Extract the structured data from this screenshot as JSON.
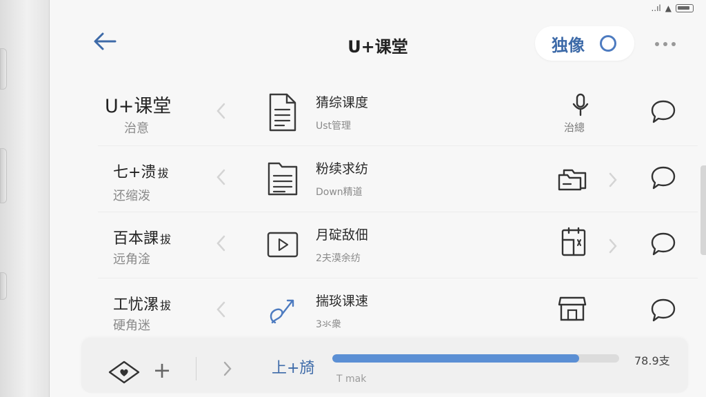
{
  "status": {
    "signal": "..ıl",
    "wifi": "▲"
  },
  "header": {
    "title": "U+课堂",
    "pill_label": "独像"
  },
  "rows": [
    {
      "left_title": "U+课堂",
      "left_tag": "",
      "left_sub": "治意",
      "item_title": "猜综课度",
      "item_sub": "Ust管理",
      "action_label": "治總",
      "action_icon": "mic-icon",
      "item_icon": "document-icon"
    },
    {
      "left_title": "七+溃",
      "left_tag": "拔",
      "left_sub": "还缩泼",
      "item_title": "粉续求纺",
      "item_sub": "Down精道",
      "action_label": "",
      "action_icon": "folders-icon",
      "item_icon": "folder-document-icon"
    },
    {
      "left_title": "百本課",
      "left_tag": "拔",
      "left_sub": "远角淦",
      "item_title": "月碇敌佃",
      "item_sub": "2夫漠余纺",
      "action_label": "",
      "action_icon": "clipboard-icon",
      "item_icon": "play-icon"
    },
    {
      "left_title": "工忧漯",
      "left_tag": "拔",
      "left_sub": "硬角迷",
      "item_title": "揣琰课速",
      "item_sub": "3氺衆",
      "action_label": "",
      "action_icon": "store-icon",
      "item_icon": "link-icon"
    }
  ],
  "bottom_bar": {
    "label": "上+旑",
    "progress": 0.86,
    "progress_value": "78.9支",
    "progress_sub": "T mak"
  },
  "colors": {
    "accent": "#3d6aa8",
    "progress": "#5b8fd4"
  }
}
